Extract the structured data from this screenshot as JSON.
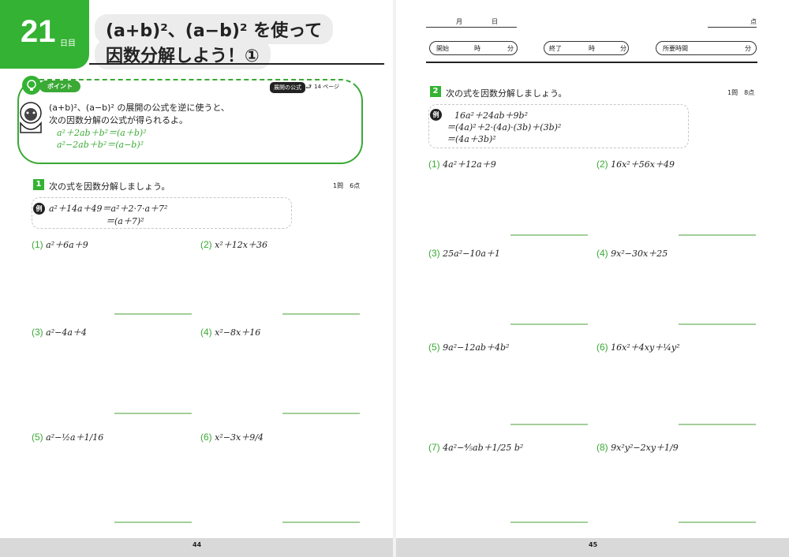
{
  "header": {
    "day_number": "21",
    "day_unit": "日目",
    "title_line1": "(a+b)²、(a−b)² を使って",
    "title_line2": "因数分解しよう！①",
    "month_label": "月",
    "day_label": "日",
    "score_label": "点",
    "start_label": "開始",
    "end_label": "終了",
    "elapsed_label": "所要時間",
    "hour_label": "時",
    "minute_label": "分"
  },
  "point": {
    "badge": "ポイント",
    "ref_label": "展開の公式",
    "ref_page": "14 ページ",
    "line1": "(a+b)²、(a−b)² の展開の公式を逆に使うと、",
    "line2": "次の因数分解の公式が得られるよ。",
    "formula1": "a²＋2ab＋b²＝(a＋b)²",
    "formula2": "a²−2ab＋b²＝(a−b)²"
  },
  "section1": {
    "number": "1",
    "title": "次の式を因数分解しましょう。",
    "points": "1問　6点",
    "example_badge": "例",
    "example_line1": "a²＋14a＋49＝a²＋2·7·a＋7²",
    "example_line2": "＝(a＋7)²",
    "problems": [
      {
        "num": "(1)",
        "expr": "a²＋6a＋9"
      },
      {
        "num": "(2)",
        "expr": "x²＋12x＋36"
      },
      {
        "num": "(3)",
        "expr": "a²−4a＋4"
      },
      {
        "num": "(4)",
        "expr": "x²−8x＋16"
      },
      {
        "num": "(5)",
        "expr": "a²−½a＋1/16"
      },
      {
        "num": "(6)",
        "expr": "x²−3x＋9/4"
      }
    ]
  },
  "section2": {
    "number": "2",
    "title": "次の式を因数分解しましょう。",
    "points": "1問　8点",
    "example_badge": "例",
    "example_line1": "16a²＋24ab＋9b²",
    "example_line2": "＝(4a)²＋2·(4a)·(3b)＋(3b)²",
    "example_line3": "＝(4a＋3b)²",
    "problems": [
      {
        "num": "(1)",
        "expr": "4a²＋12a＋9"
      },
      {
        "num": "(2)",
        "expr": "16x²＋56x＋49"
      },
      {
        "num": "(3)",
        "expr": "25a²−10a＋1"
      },
      {
        "num": "(4)",
        "expr": "9x²−30x＋25"
      },
      {
        "num": "(5)",
        "expr": "9a²−12ab＋4b²"
      },
      {
        "num": "(6)",
        "expr": "16x²＋4xy＋¼y²"
      },
      {
        "num": "(7)",
        "expr": "4a²−⅘ab＋1/25 b²"
      },
      {
        "num": "(8)",
        "expr": "9x²y²−2xy＋1/9"
      }
    ]
  },
  "footer": {
    "page_left": "44",
    "page_right": "45"
  },
  "colors": {
    "accent": "#34b233",
    "answer_line": "#a3cf9a",
    "footer": "#d9d9d9"
  }
}
